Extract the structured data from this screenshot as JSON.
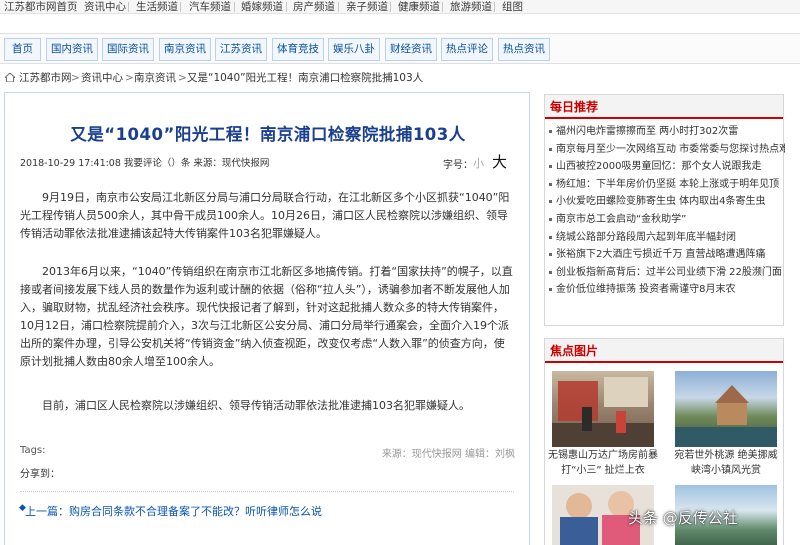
{
  "topnav": [
    "江苏都市网首页",
    "资讯中心",
    "生活频道",
    "汽车频道",
    "婚嫁频道",
    "房产频道",
    "亲子频道",
    "健康频道",
    "旅游频道",
    "组图"
  ],
  "subnav": [
    "首页",
    "国内资讯",
    "国际资讯",
    "南京资讯",
    "江苏资讯",
    "体育竞技",
    "娱乐八卦",
    "财经资讯",
    "热点评论",
    "热点资讯"
  ],
  "breadcrumb": {
    "items": [
      "江苏都市网",
      "资讯中心",
      "南京资讯",
      "又是“1040”阳光工程！南京浦口检察院批捕103人"
    ],
    "separator": ">"
  },
  "article": {
    "title": "又是“1040”阳光工程！南京浦口检察院批捕103人",
    "meta": "2018-10-29 17:41:08  我要评论（）条  来源：现代快报网",
    "font_label": "字号：",
    "font_small": "小",
    "font_big": "大",
    "paragraphs": [
      "9月19日，南京市公安局江北新区分局与浦口分局联合行动，在江北新区多个小区抓获“1040”阳光工程传销人员500余人，其中骨干成员100余人。10月26日，浦口区人民检察院以涉嫌组织、领导传销活动罪依法批准逮捕该起特大传销案件103名犯罪嫌疑人。",
      "2013年6月以来，“1040”传销组织在南京市江北新区多地搞传销。打着“国家扶持”的幌子，以直接或者间接发展下线人员的数量作为返利或计酬的依据（俗称“拉人头”），诱骗参加者不断发展他人加入，骗取财物，扰乱经济社会秩序。现代快报记者了解到，针对这起批捕人数众多的特大传销案件，10月12日，浦口检察院提前介入，3次与江北新区公安分局、浦口分局举行通案会，全面介入19个派出所的案件办理，引导公安机关将“传销资金”纳入侦查视距，改变仅考虑“人数入罪”的侦查方向，使原计划批捕人数由80余人增至100余人。",
      "目前，浦口区人民检察院以涉嫌组织、领导传销活动罪依法批准逮捕103名犯罪嫌疑人。"
    ],
    "tags_label": "Tags:",
    "share_label": "分享到：",
    "source_line": "来源：现代快报网  编辑：刘枫",
    "prev_link": "上一篇：购房合同条款不合理备案了不能改？听听律师怎么说"
  },
  "daily": {
    "title": "每日推荐",
    "items": [
      "福州闪电炸雷擦擦而至 两小时打302次雷",
      "南京每月至少一次网络互动 市委常委与您探讨热点难点",
      "山西被控2000吸男童回忆：那个女人说跟我走",
      "杨红旭：下半年房价仍坚挺 本轮上涨或于明年见顶",
      "小伙爱吃田螺险变肺寄生虫 体内取出4条寄生虫",
      "南京市总工会启动“金秋助学”",
      "绕城公路部分路段周六起到年底半幅封闭",
      "张裕旗下2大酒庄亏损近千万 直营战略遭遇阵痛",
      "创业板指新高背后：过半公司业绩下滑 22股濒门面",
      "金价低位维持振荡 投资者需谨守8月末农"
    ]
  },
  "photos": {
    "title": "焦点图片",
    "items": [
      {
        "caption": "无锡惠山万达广场房前暴打“小三” 扯烂上衣"
      },
      {
        "caption": "宛若世外桃源 绝美挪威峡湾小镇风光赏"
      },
      {
        "caption": ""
      },
      {
        "caption": ""
      }
    ]
  },
  "watermark": "头条 @反传公社"
}
